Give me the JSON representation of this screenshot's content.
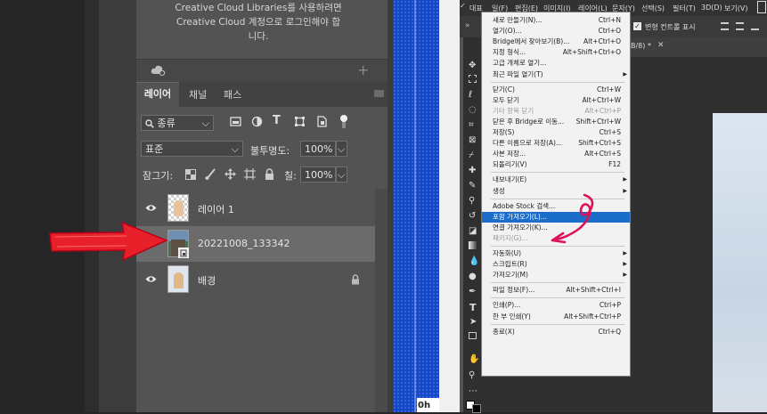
{
  "left": {
    "cc_message": [
      "Creative Cloud Libraries를 사용하려면",
      "Creative Cloud 계정으로 로그인해야 합",
      "니다."
    ],
    "tabs": [
      "레이어",
      "채널",
      "패스"
    ],
    "filter": {
      "label": "종류",
      "icons": [
        "image-icon",
        "adjust-icon",
        "type-icon",
        "shape-icon",
        "smart-icon",
        "toggle-icon"
      ]
    },
    "blend_mode": "표준",
    "opacity_label": "불투명도:",
    "opacity_value": "100%",
    "lock_label": "잠그기:",
    "fill_label": "칠:",
    "fill_value": "100%",
    "layers": [
      {
        "name": "레이어 1"
      },
      {
        "name": "20221008_133342"
      },
      {
        "name": "배경"
      }
    ]
  },
  "blue_bottom_text": "0h",
  "right": {
    "menubar": [
      "대표",
      "일(F)",
      "편집(E)",
      "이미지(I)",
      "레이어(L)",
      "문자(Y)",
      "선택(S)",
      "필터(T)",
      "3D(D)",
      "보기(V)"
    ],
    "options": {
      "checkbox_label": "변형 컨트롤 표시"
    },
    "doc_tab": "B/8) *",
    "menu": [
      {
        "label": "새로 만들기(N)...",
        "shortcut": "Ctrl+N"
      },
      {
        "label": "열기(O)...",
        "shortcut": "Ctrl+O"
      },
      {
        "label": "Bridge에서 찾아보기(B)...",
        "shortcut": "Alt+Ctrl+O"
      },
      {
        "label": "지정 형식...",
        "shortcut": "Alt+Shift+Ctrl+O"
      },
      {
        "label": "고급 개체로 열기..."
      },
      {
        "label": "최근 파일 열기(T)",
        "submenu": true
      },
      {
        "separator": true
      },
      {
        "label": "닫기(C)",
        "shortcut": "Ctrl+W"
      },
      {
        "label": "모두 닫기",
        "shortcut": "Alt+Ctrl+W"
      },
      {
        "label": "기타 항목 닫기",
        "shortcut": "Alt+Ctrl+P",
        "disabled": true
      },
      {
        "label": "닫은 후 Bridge로 이동...",
        "shortcut": "Shift+Ctrl+W"
      },
      {
        "label": "저장(S)",
        "shortcut": "Ctrl+S"
      },
      {
        "label": "다른 이름으로 저장(A)...",
        "shortcut": "Shift+Ctrl+S"
      },
      {
        "label": "사본 저장...",
        "shortcut": "Alt+Ctrl+S"
      },
      {
        "label": "되돌리기(V)",
        "shortcut": "F12"
      },
      {
        "separator": true
      },
      {
        "label": "내보내기(E)",
        "submenu": true
      },
      {
        "label": "생성",
        "submenu": true
      },
      {
        "separator": true
      },
      {
        "label": "Adobe Stock 검색..."
      },
      {
        "label": "포함 가져오기(L)...",
        "highlighted": true
      },
      {
        "label": "연결 가져오기(K)..."
      },
      {
        "label": "패키지(G)...",
        "disabled": true
      },
      {
        "separator": true
      },
      {
        "label": "자동화(U)",
        "submenu": true
      },
      {
        "label": "스크립트(R)",
        "submenu": true
      },
      {
        "label": "가져오기(M)",
        "submenu": true
      },
      {
        "separator": true
      },
      {
        "label": "파일 정보(F)...",
        "shortcut": "Alt+Shift+Ctrl+I"
      },
      {
        "separator": true
      },
      {
        "label": "인쇄(P)...",
        "shortcut": "Ctrl+P"
      },
      {
        "label": "한 부 인쇄(Y)",
        "shortcut": "Alt+Shift+Ctrl+P"
      },
      {
        "separator": true
      },
      {
        "label": "종료(X)",
        "shortcut": "Ctrl+Q"
      }
    ]
  },
  "colors": {
    "accent_red": "#e8202a",
    "highlight": "#1a6ec9",
    "annotation": "#e0105a"
  }
}
